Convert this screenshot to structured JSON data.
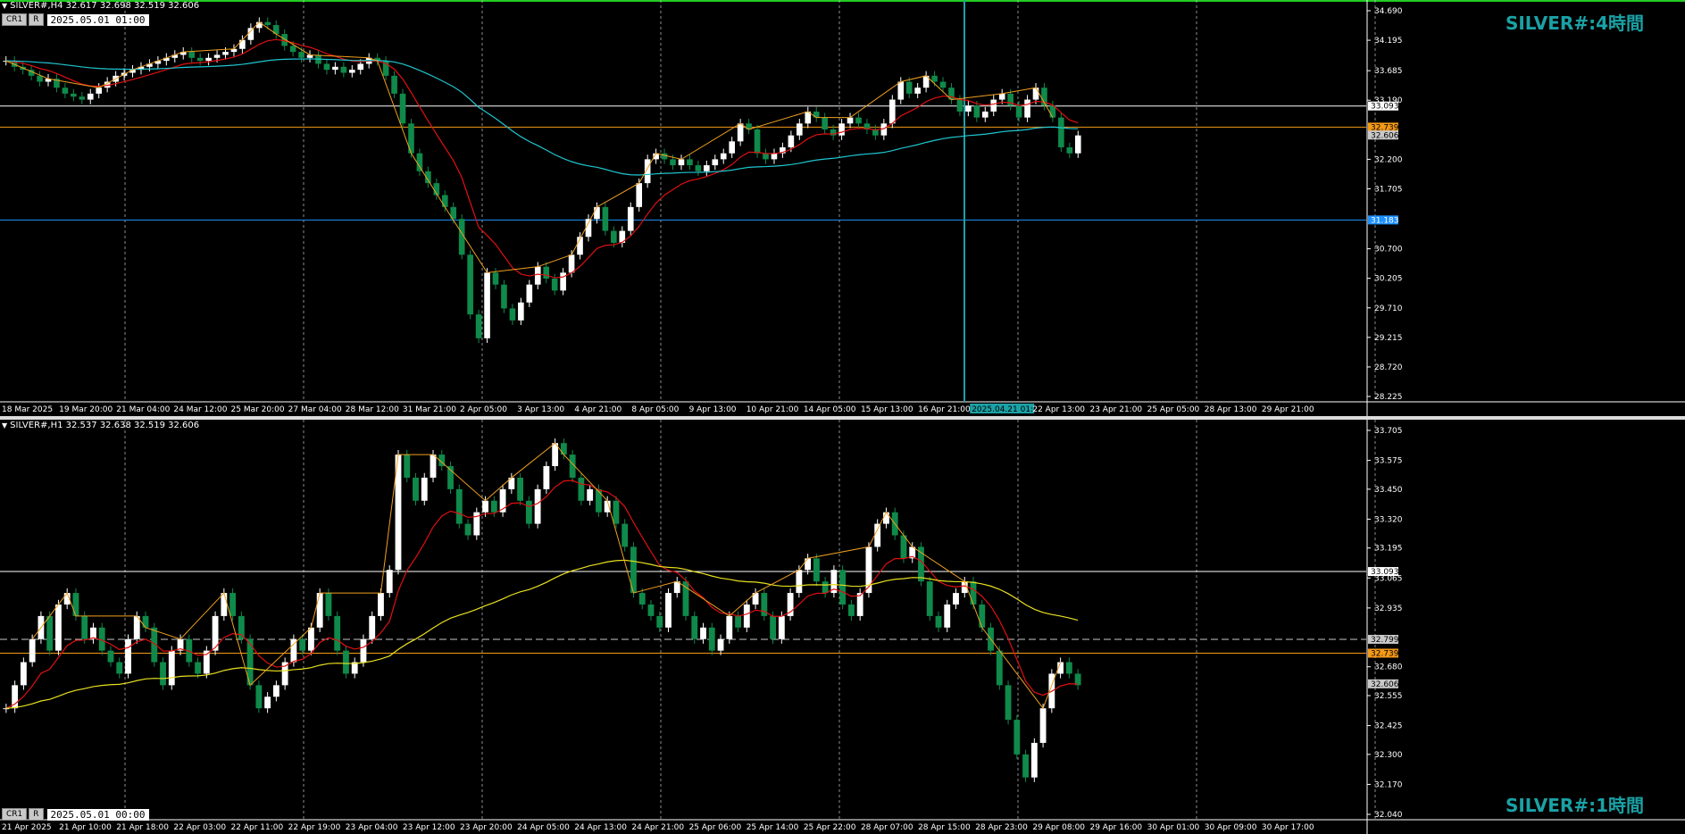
{
  "panes": [
    {
      "id": "h4",
      "symbol_line": "SILVER#,H4  32.617 32.698 32.519 32.606",
      "buttons": [
        "CR1",
        "R"
      ],
      "datetime": "2025.05.01 01:00",
      "timeframe_label": "SILVER#:4時間",
      "price_ticks": [
        "34.690",
        "34.195",
        "33.685",
        "33.190",
        "32.200",
        "31.705",
        "30.700",
        "30.205",
        "29.710",
        "29.215",
        "28.720",
        "28.225"
      ],
      "price_tags": [
        {
          "label": "33.093",
          "value": 33.093,
          "color": "#ffffff",
          "text": "#000000",
          "line": "solid"
        },
        {
          "label": "32.739",
          "value": 32.739,
          "color": "#f59a17",
          "text": "#000000",
          "line": "solid"
        },
        {
          "label": "32.606",
          "value": 32.606,
          "color": "#c8c8c8",
          "text": "#000000",
          "line": "none"
        },
        {
          "label": "31.183",
          "value": 31.183,
          "color": "#1e90ff",
          "text": "#ffffff",
          "line": "solid"
        }
      ],
      "time_labels": [
        "18 Mar 2025",
        "19 Mar 20:00",
        "21 Mar 04:00",
        "24 Mar 12:00",
        "25 Mar 20:00",
        "27 Mar 04:00",
        "28 Mar 12:00",
        "31 Mar 21:00",
        "2 Apr 05:00",
        "3 Apr 13:00",
        "4 Apr 21:00",
        "8 Apr 05:00",
        "9 Apr 13:00",
        "10 Apr 21:00",
        "14 Apr 05:00",
        "15 Apr 13:00",
        "16 Apr 21:00",
        "2025.04.21 01:00",
        "22 Apr 13:00",
        "23 Apr 21:00",
        "25 Apr 05:00",
        "28 Apr 13:00",
        "29 Apr 21:00"
      ],
      "cursor_time": "2025.04.21 01:00"
    },
    {
      "id": "h1",
      "symbol_line": "SILVER#,H1  32.537 32.638 32.519 32.606",
      "buttons": [
        "CR1",
        "R"
      ],
      "datetime": "2025.05.01 00:00",
      "timeframe_label": "SILVER#:1時間",
      "price_ticks": [
        "33.705",
        "33.575",
        "33.450",
        "33.320",
        "33.195",
        "33.065",
        "32.935",
        "32.680",
        "32.555",
        "32.425",
        "32.300",
        "32.170",
        "32.040"
      ],
      "price_tags": [
        {
          "label": "33.093",
          "value": 33.093,
          "color": "#ffffff",
          "text": "#000000",
          "line": "solid"
        },
        {
          "label": "32.799",
          "value": 32.799,
          "color": "#c8c8c8",
          "text": "#000000",
          "line": "dashed"
        },
        {
          "label": "32.739",
          "value": 32.739,
          "color": "#f59a17",
          "text": "#000000",
          "line": "solid"
        },
        {
          "label": "32.606",
          "value": 32.606,
          "color": "#c8c8c8",
          "text": "#000000",
          "line": "none"
        }
      ],
      "time_labels": [
        "21 Apr 2025",
        "21 Apr 10:00",
        "21 Apr 18:00",
        "22 Apr 03:00",
        "22 Apr 11:00",
        "22 Apr 19:00",
        "23 Apr 04:00",
        "23 Apr 12:00",
        "23 Apr 20:00",
        "24 Apr 05:00",
        "24 Apr 13:00",
        "24 Apr 21:00",
        "25 Apr 06:00",
        "25 Apr 14:00",
        "25 Apr 22:00",
        "28 Apr 07:00",
        "28 Apr 15:00",
        "28 Apr 23:00",
        "29 Apr 08:00",
        "29 Apr 16:00",
        "30 Apr 01:00",
        "30 Apr 09:00",
        "30 Apr 17:00"
      ]
    }
  ],
  "colors": {
    "background": "#000000",
    "bull_candle": "#ffffff",
    "bear_candle": "#0f8a4a",
    "ma_fast": "#e01010",
    "ma_slow_h4": "#20c6d0",
    "ma_slow_h1": "#e8e020",
    "zigzag": "#f0a020",
    "grid": "#c8c8c8",
    "top_border": "#22cc22",
    "cursor_line": "#1aa2a6",
    "label_teal": "#1aa2a6"
  },
  "chart_data": [
    {
      "type": "candlestick",
      "symbol": "SILVER#",
      "timeframe": "H4",
      "ylim": [
        28.225,
        34.69
      ],
      "ohlc_close_path": [
        33.85,
        33.75,
        33.7,
        33.6,
        33.5,
        33.55,
        33.4,
        33.3,
        33.25,
        33.2,
        33.3,
        33.4,
        33.5,
        33.6,
        33.65,
        33.7,
        33.75,
        33.8,
        33.85,
        33.9,
        33.95,
        34.0,
        33.9,
        33.85,
        33.9,
        33.95,
        34.0,
        34.05,
        34.2,
        34.4,
        34.5,
        34.45,
        34.3,
        34.1,
        34.0,
        33.9,
        33.95,
        33.8,
        33.7,
        33.75,
        33.65,
        33.7,
        33.8,
        33.9,
        33.85,
        33.6,
        33.3,
        32.8,
        32.3,
        32.0,
        31.8,
        31.6,
        31.4,
        31.2,
        30.6,
        29.6,
        29.2,
        30.3,
        30.1,
        29.7,
        29.5,
        29.8,
        30.1,
        30.4,
        30.2,
        30.0,
        30.3,
        30.6,
        30.9,
        31.2,
        31.4,
        31.0,
        30.8,
        31.0,
        31.4,
        31.8,
        32.2,
        32.3,
        32.2,
        32.1,
        32.2,
        32.1,
        32.0,
        32.1,
        32.2,
        32.3,
        32.5,
        32.8,
        32.7,
        32.3,
        32.2,
        32.3,
        32.4,
        32.6,
        32.8,
        33.0,
        32.9,
        32.7,
        32.6,
        32.8,
        32.9,
        32.8,
        32.7,
        32.6,
        32.8,
        33.2,
        33.5,
        33.3,
        33.4,
        33.6,
        33.5,
        33.4,
        33.2,
        33.0,
        33.1,
        32.9,
        33.0,
        33.2,
        33.3,
        33.1,
        32.9,
        33.2,
        33.4,
        33.1,
        32.9,
        32.4,
        32.3,
        32.6
      ]
    },
    {
      "type": "candlestick",
      "symbol": "SILVER#",
      "timeframe": "H1",
      "ylim": [
        32.04,
        33.705
      ],
      "ohlc_close_path": [
        32.5,
        32.6,
        32.7,
        32.8,
        32.9,
        32.75,
        32.95,
        33.0,
        32.9,
        32.8,
        32.85,
        32.75,
        32.7,
        32.65,
        32.8,
        32.9,
        32.85,
        32.7,
        32.6,
        32.75,
        32.8,
        32.7,
        32.65,
        32.75,
        32.9,
        33.0,
        32.9,
        32.8,
        32.6,
        32.5,
        32.55,
        32.6,
        32.7,
        32.8,
        32.75,
        32.85,
        33.0,
        32.9,
        32.75,
        32.65,
        32.7,
        32.8,
        32.9,
        33.0,
        33.1,
        33.6,
        33.5,
        33.4,
        33.5,
        33.6,
        33.55,
        33.45,
        33.3,
        33.25,
        33.35,
        33.4,
        33.35,
        33.45,
        33.5,
        33.4,
        33.3,
        33.45,
        33.55,
        33.65,
        33.6,
        33.5,
        33.4,
        33.45,
        33.35,
        33.4,
        33.3,
        33.2,
        33.0,
        32.95,
        32.9,
        32.85,
        33.0,
        33.05,
        32.9,
        32.8,
        32.85,
        32.75,
        32.8,
        32.9,
        32.85,
        32.95,
        33.0,
        32.9,
        32.8,
        32.9,
        33.0,
        33.1,
        33.15,
        33.05,
        33.0,
        33.1,
        32.95,
        32.9,
        33.0,
        33.2,
        33.3,
        33.35,
        33.25,
        33.15,
        33.2,
        33.05,
        32.9,
        32.85,
        32.95,
        33.0,
        33.05,
        32.95,
        32.85,
        32.75,
        32.6,
        32.45,
        32.3,
        32.2,
        32.35,
        32.5,
        32.65,
        32.7,
        32.65,
        32.6
      ]
    }
  ]
}
